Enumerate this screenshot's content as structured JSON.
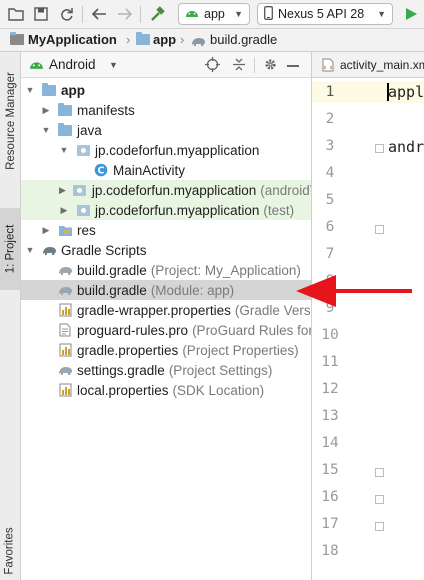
{
  "toolbar": {
    "config_name": "app",
    "device_name": "Nexus 5 API 28"
  },
  "breadcrumb": {
    "project": "MyApplication",
    "module": "app",
    "file": "build.gradle"
  },
  "sidebar": {
    "tab_resource_manager": "Resource Manager",
    "tab_project": "1: Project",
    "tab_favorites": "Favorites"
  },
  "panel": {
    "view_mode": "Android"
  },
  "tree": [
    {
      "label": "app",
      "hint": ""
    },
    {
      "label": "manifests",
      "hint": ""
    },
    {
      "label": "java",
      "hint": ""
    },
    {
      "label": "jp.codeforfun.myapplication",
      "hint": ""
    },
    {
      "label": "MainActivity",
      "hint": ""
    },
    {
      "label": "jp.codeforfun.myapplication",
      "hint": "(androidTest)"
    },
    {
      "label": "jp.codeforfun.myapplication",
      "hint": "(test)"
    },
    {
      "label": "res",
      "hint": ""
    },
    {
      "label": "Gradle Scripts",
      "hint": ""
    },
    {
      "label": "build.gradle",
      "hint": "(Project: My_Application)"
    },
    {
      "label": "build.gradle",
      "hint": "(Module: app)"
    },
    {
      "label": "gradle-wrapper.properties",
      "hint": "(Gradle Version)"
    },
    {
      "label": "proguard-rules.pro",
      "hint": "(ProGuard Rules for app)"
    },
    {
      "label": "gradle.properties",
      "hint": "(Project Properties)"
    },
    {
      "label": "settings.gradle",
      "hint": "(Project Settings)"
    },
    {
      "label": "local.properties",
      "hint": "(SDK Location)"
    }
  ],
  "editor": {
    "tab_title": "activity_main.xml",
    "lines": [
      "1",
      "2",
      "3",
      "4",
      "5",
      "6",
      "7",
      "8",
      "9",
      "10",
      "11",
      "12",
      "13",
      "14",
      "15",
      "16",
      "17",
      "18"
    ],
    "code_line1": "appl",
    "code_line3": "andr"
  },
  "colors": {
    "selected_row": "#d5d5d5",
    "test_row": "#e9f5e3",
    "arrow": "#e8141b",
    "current_line": "#fdfbe3"
  }
}
